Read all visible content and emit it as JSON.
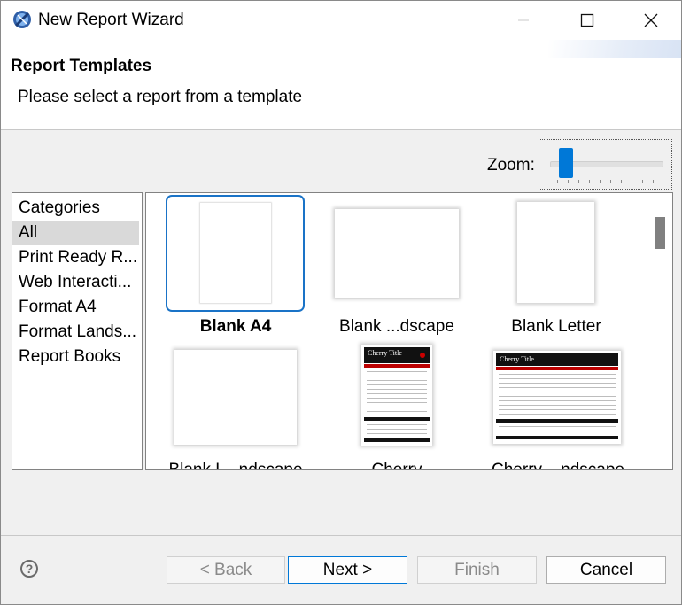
{
  "window": {
    "title": "New Report Wizard",
    "icon": "eclipse-birt-icon"
  },
  "header": {
    "title": "Report Templates",
    "description": "Please select a report from a template"
  },
  "zoom": {
    "label": "Zoom:",
    "level": 0.1
  },
  "categories": {
    "heading": "Categories",
    "items": [
      "All",
      "Print Ready R...",
      "Web Interacti...",
      "Format A4",
      "Format Lands...",
      "Report Books"
    ],
    "selected": "All"
  },
  "templates": [
    {
      "label": "Blank A4",
      "selected": true
    },
    {
      "label": "Blank ...dscape"
    },
    {
      "label": "Blank Letter"
    },
    {
      "label": "Blank L...ndscape"
    },
    {
      "label": "Cherry",
      "preview_title": "Cherry Title"
    },
    {
      "label": "Cherry ...ndscape",
      "preview_title": "Cherry Title"
    }
  ],
  "buttons": {
    "help": "?",
    "back": "< Back",
    "next": "Next >",
    "finish": "Finish",
    "cancel": "Cancel"
  },
  "colors": {
    "accent": "#0078d7",
    "selection_border": "#1a73c7",
    "cherry_red": "#bb0000"
  }
}
